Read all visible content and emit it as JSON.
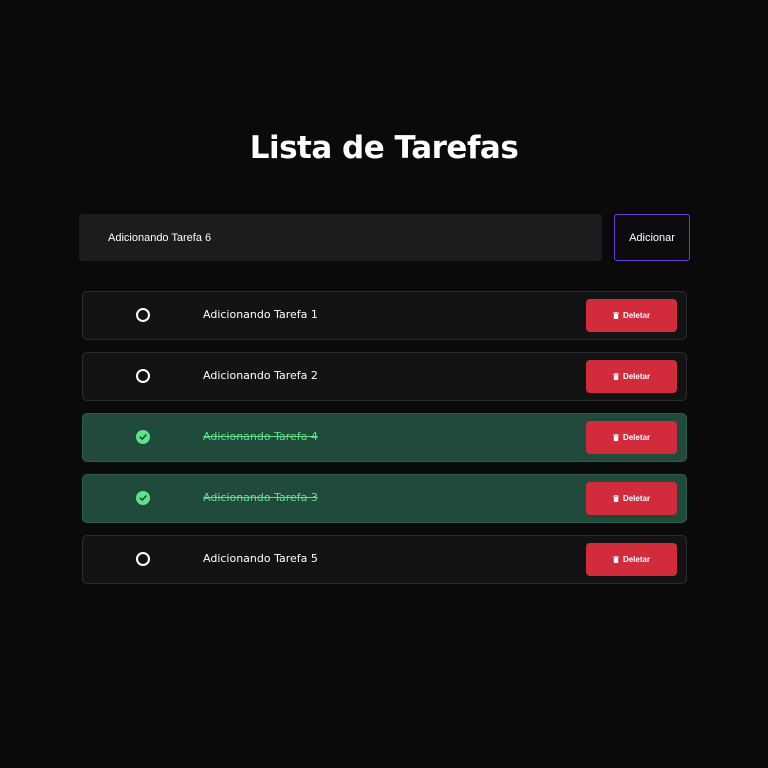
{
  "app": {
    "title": "Lista de Tarefas"
  },
  "add_form": {
    "input_value": "Adicionando Tarefa 6",
    "button_label": "Adicionar"
  },
  "tasks": [
    {
      "text": "Adicionando Tarefa 1",
      "completed": false,
      "delete_label": "Deletar"
    },
    {
      "text": "Adicionando Tarefa 2",
      "completed": false,
      "delete_label": "Deletar"
    },
    {
      "text": "Adicionando Tarefa 4",
      "completed": true,
      "delete_label": "Deletar"
    },
    {
      "text": "Adicionando Tarefa 3",
      "completed": true,
      "delete_label": "Deletar"
    },
    {
      "text": "Adicionando Tarefa 5",
      "completed": false,
      "delete_label": "Deletar"
    }
  ],
  "icons": {
    "check": "check-circle-icon",
    "uncheck": "circle-outline-icon",
    "delete": "trash-icon"
  },
  "colors": {
    "background": "#0a0a0a",
    "accent_border": "#6a3bd8",
    "completed_bg": "#204a3c",
    "completed_text": "#5fe08a",
    "delete_button": "#d22b3c"
  }
}
